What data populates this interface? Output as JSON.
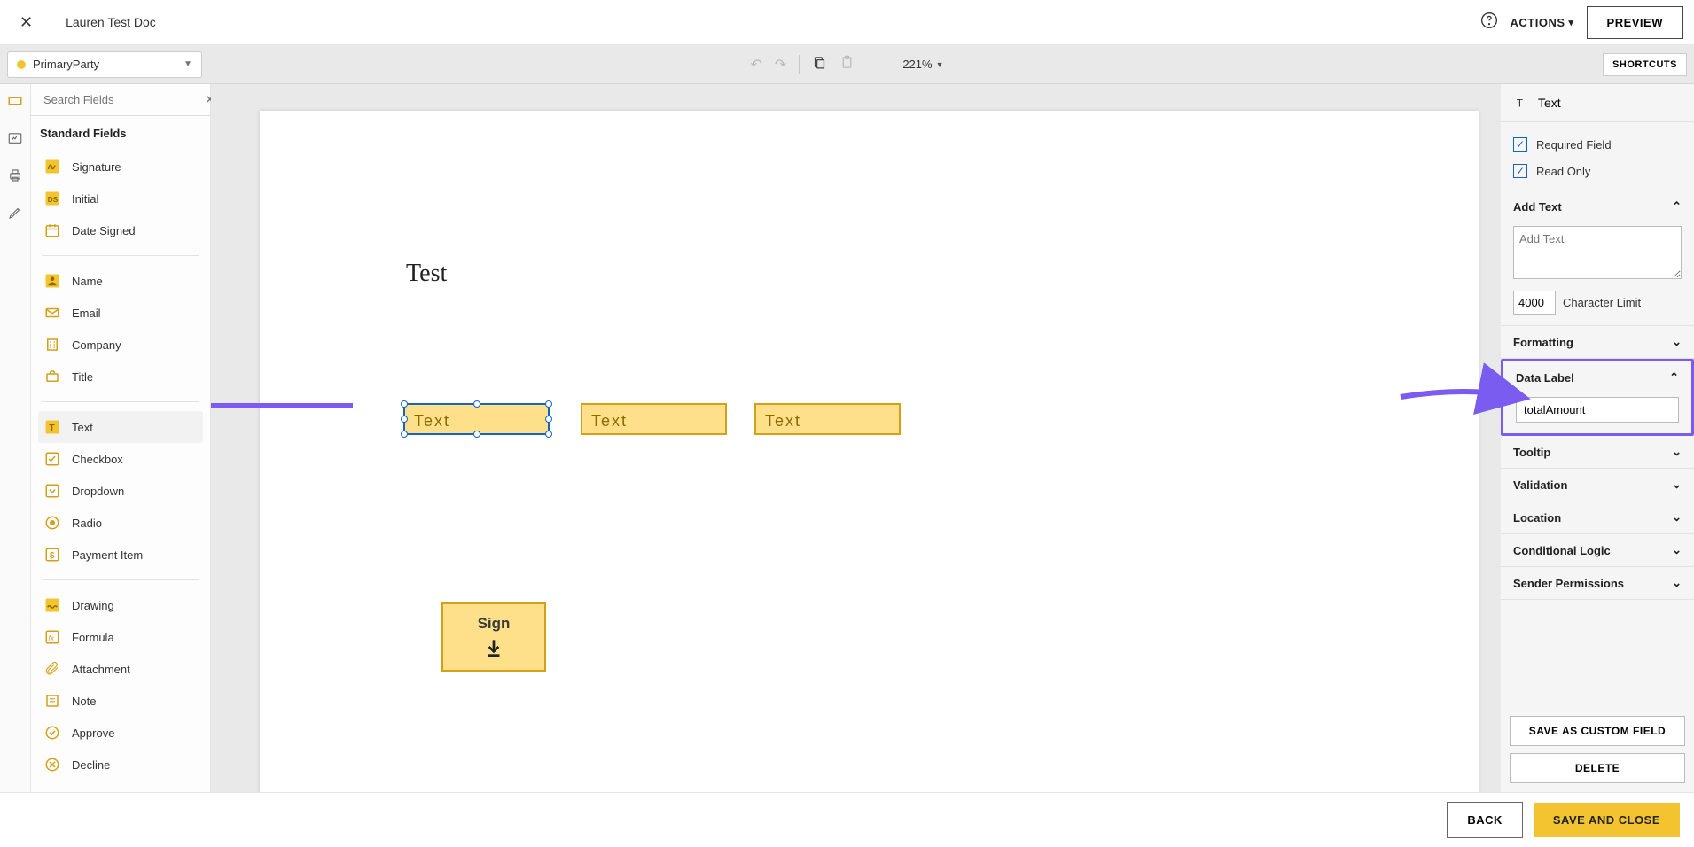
{
  "topbar": {
    "doc_title": "Lauren Test Doc",
    "actions_label": "ACTIONS",
    "preview_label": "PREVIEW"
  },
  "toolbar": {
    "party_name": "PrimaryParty",
    "zoom": "221%",
    "shortcuts_label": "SHORTCUTS"
  },
  "left_panel": {
    "search_placeholder": "Search Fields",
    "category_header": "Standard Fields",
    "fields_group1": [
      "Signature",
      "Initial",
      "Date Signed"
    ],
    "fields_group2": [
      "Name",
      "Email",
      "Company",
      "Title"
    ],
    "fields_group3": [
      "Text",
      "Checkbox",
      "Dropdown",
      "Radio",
      "Payment Item"
    ],
    "fields_group4": [
      "Drawing",
      "Formula",
      "Attachment",
      "Note",
      "Approve",
      "Decline"
    ]
  },
  "canvas": {
    "heading": "Test",
    "text_field_label": "Text",
    "sign_label": "Sign"
  },
  "right_panel": {
    "type_label": "Text",
    "required_label": "Required Field",
    "readonly_label": "Read Only",
    "add_text_header": "Add Text",
    "add_text_placeholder": "Add Text",
    "char_limit_value": "4000",
    "char_limit_label": "Character Limit",
    "formatting_header": "Formatting",
    "data_label_header": "Data Label",
    "data_label_value": "totalAmount",
    "tooltip_header": "Tooltip",
    "validation_header": "Validation",
    "location_header": "Location",
    "conditional_header": "Conditional Logic",
    "sender_perm_header": "Sender Permissions",
    "save_custom_label": "SAVE AS CUSTOM FIELD",
    "delete_label": "DELETE"
  },
  "bottombar": {
    "back_label": "BACK",
    "save_close_label": "SAVE AND CLOSE"
  }
}
